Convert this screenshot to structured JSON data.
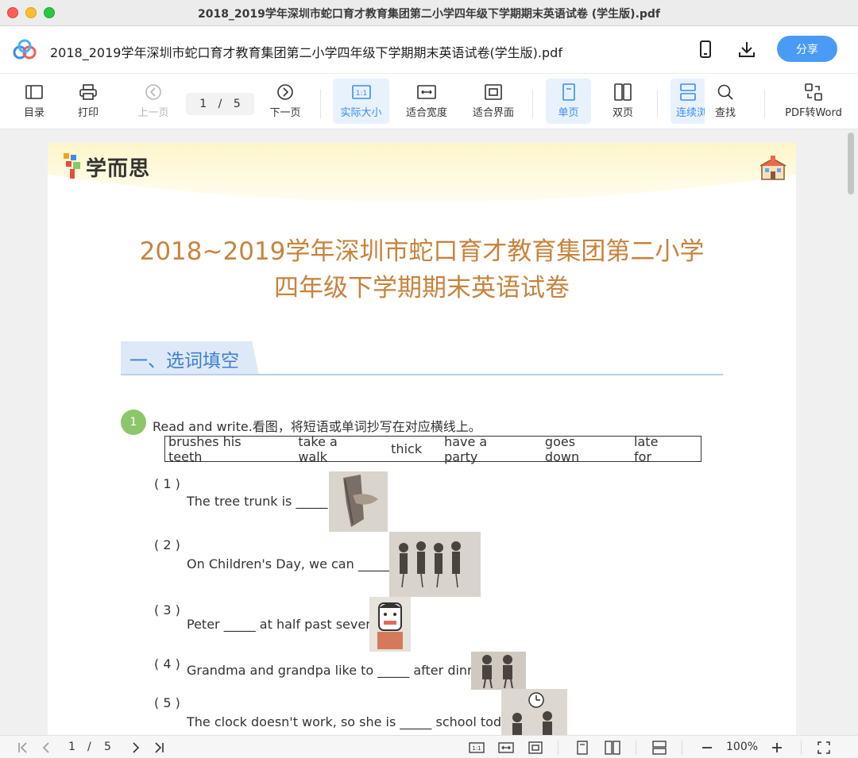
{
  "window": {
    "title": "2018_2019学年深圳市蛇口育才教育集团第二小学四年级下学期期末英语试卷 (学生版).pdf"
  },
  "header": {
    "doc_name": "2018_2019学年深圳市蛇口育才教育集团第二小学四年级下学期期末英语试卷(学生版).pdf",
    "share_label": "分享",
    "accent_color": "#4a9bf5"
  },
  "toolbar": {
    "catalog": "目录",
    "print": "打印",
    "prev": "上一页",
    "page_current": "1",
    "page_sep": "/",
    "page_total": "5",
    "next": "下一页",
    "actual_size": "实际大小",
    "fit_width": "适合宽度",
    "fit_page": "适合界面",
    "single": "单页",
    "double": "双页",
    "continuous": "连续浏",
    "search": "查找",
    "pdf_to_word": "PDF转Word"
  },
  "document": {
    "brand": "学而思",
    "title_line1": "2018~2019学年深圳市蛇口育才教育集团第二小学",
    "title_line2": "四年级下学期期末英语试卷",
    "section": "一、选词填空",
    "question_number": "1",
    "instruction": "Read and write.看图，将短语或单词抄写在对应横线上。",
    "word_bank": [
      "brushes his teeth",
      "take a walk",
      "thick",
      "have a party",
      "goes down",
      "late for"
    ],
    "items": [
      {
        "num": "( 1 )",
        "text": "The tree trunk is _____ ."
      },
      {
        "num": "( 2 )",
        "text": "On Children's Day, we can _____ ."
      },
      {
        "num": "( 3 )",
        "text": "Peter _____ at half past seven."
      },
      {
        "num": "( 4 )",
        "text": "Grandma and grandpa like to _____ after dinner."
      },
      {
        "num": "( 5 )",
        "text": "The clock doesn't work, so she is _____ school today."
      }
    ]
  },
  "statusbar": {
    "page_current": "1",
    "page_sep": "/",
    "page_total": "5",
    "zoom": "100%"
  }
}
